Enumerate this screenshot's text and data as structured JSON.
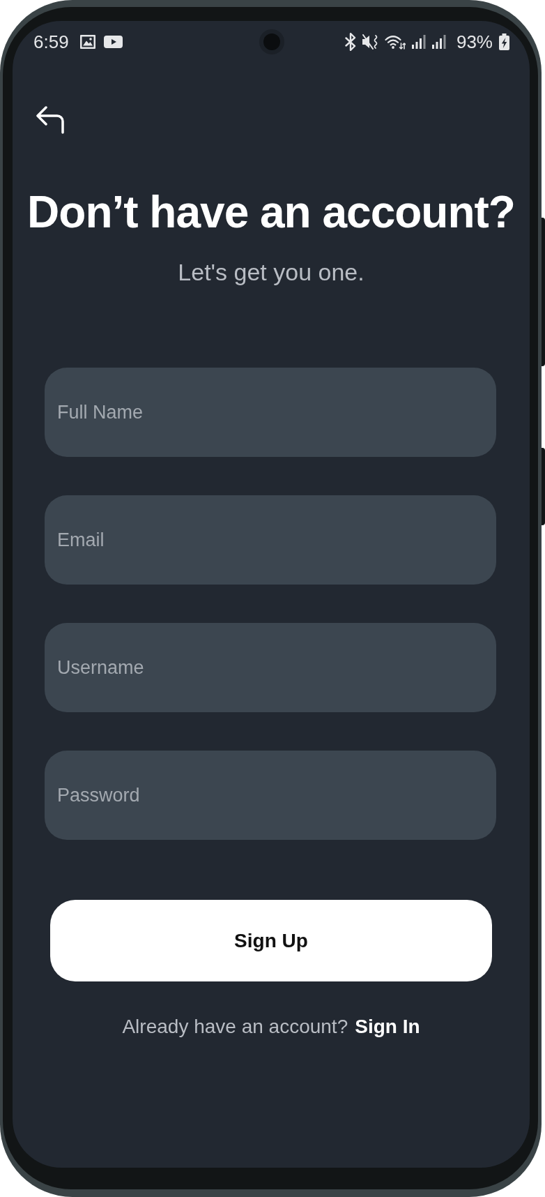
{
  "status_bar": {
    "time": "6:59",
    "battery": "93%"
  },
  "header": {
    "title": "Don’t have an account?",
    "subtitle": "Let's get you one."
  },
  "fields": [
    {
      "placeholder": "Full Name"
    },
    {
      "placeholder": "Email"
    },
    {
      "placeholder": "Username"
    },
    {
      "placeholder": "Password"
    }
  ],
  "primary_button": {
    "label": "Sign Up"
  },
  "footer": {
    "prompt": "Already have an account?",
    "link": "Sign In"
  }
}
